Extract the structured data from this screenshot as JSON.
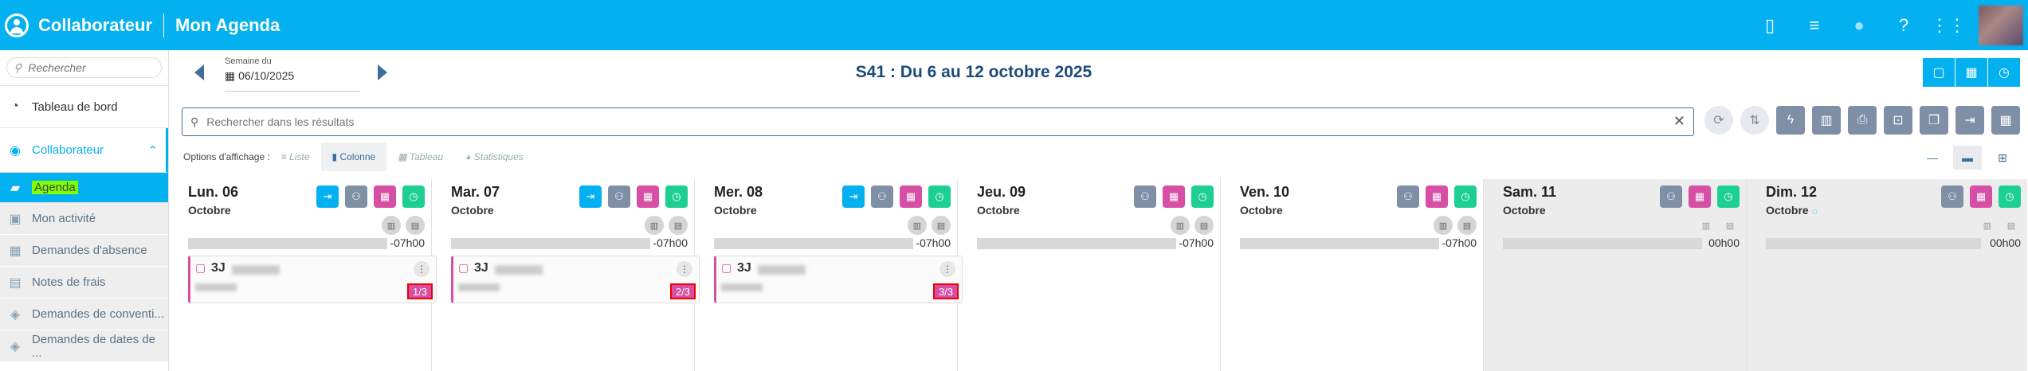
{
  "topbar": {
    "app_title": "Collaborateur",
    "page_title": "Mon Agenda",
    "icons": [
      "mobile-icon",
      "sliders-icon",
      "lightbulb-icon",
      "help-icon",
      "apps-grid-icon"
    ]
  },
  "sidebar": {
    "search_placeholder": "Rechercher",
    "dashboard": "Tableau de bord",
    "collaborateur": "Collaborateur",
    "items": [
      {
        "label": "Agenda",
        "active": true
      },
      {
        "label": "Mon activité"
      },
      {
        "label": "Demandes d'absence"
      },
      {
        "label": "Notes de frais"
      },
      {
        "label": "Demandes de conventi..."
      },
      {
        "label": "Demandes de dates de ..."
      }
    ]
  },
  "nav": {
    "week_label": "Semaine du",
    "week_value": "06/10/2025",
    "title": "S41 : Du 6 au 12 octobre 2025"
  },
  "search": {
    "placeholder": "Rechercher dans les résultats"
  },
  "options": {
    "label": "Options d'affichage :",
    "items": [
      {
        "label": "Liste"
      },
      {
        "label": "Colonne",
        "active": true
      },
      {
        "label": "Tableau"
      },
      {
        "label": "Statistiques"
      }
    ]
  },
  "days": [
    {
      "name": "Lun. 06",
      "month": "Octobre",
      "hours": "-07h00",
      "card": {
        "title": "3J",
        "badge": "1/3"
      }
    },
    {
      "name": "Mar. 07",
      "month": "Octobre",
      "hours": "-07h00",
      "card": {
        "title": "3J",
        "badge": "2/3"
      }
    },
    {
      "name": "Mer. 08",
      "month": "Octobre",
      "hours": "-07h00",
      "card": {
        "title": "3J",
        "badge": "3/3"
      }
    },
    {
      "name": "Jeu. 09",
      "month": "Octobre",
      "hours": "-07h00"
    },
    {
      "name": "Ven. 10",
      "month": "Octobre",
      "hours": "-07h00"
    },
    {
      "name": "Sam. 11",
      "month": "Octobre",
      "hours": "00h00"
    },
    {
      "name": "Dim. 12",
      "month": "Octobre",
      "hours": "00h00"
    }
  ],
  "colors": {
    "primary": "#03b1f0",
    "pink": "#d64fa5",
    "green": "#1dcf92",
    "grey": "#7e8fa6",
    "navy": "#1e4a7a"
  }
}
